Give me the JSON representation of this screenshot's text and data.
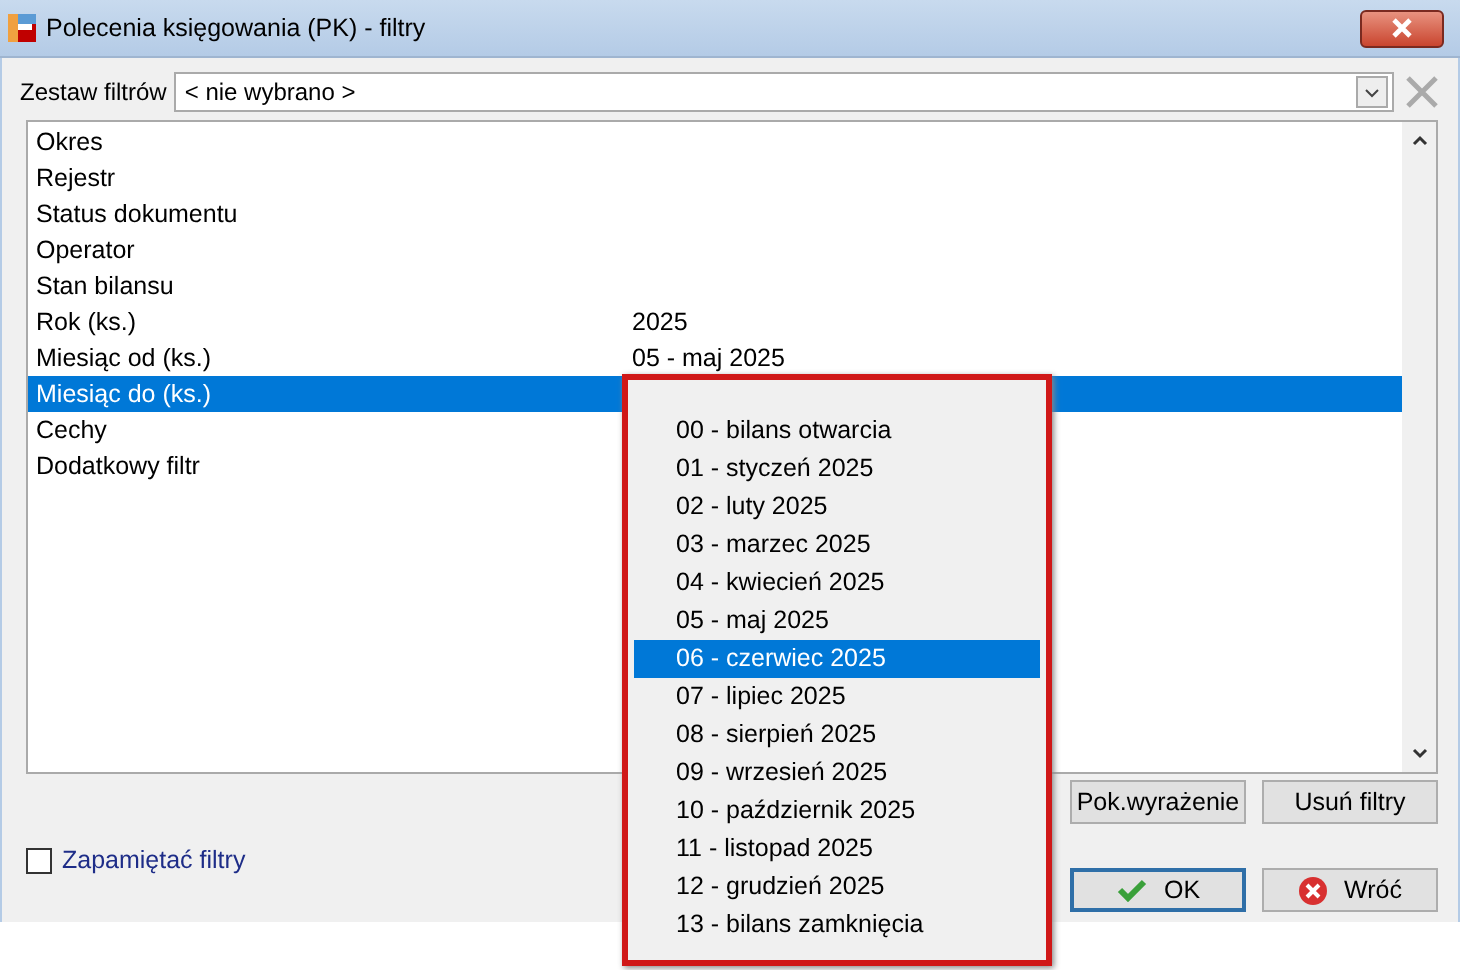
{
  "window": {
    "title": "Polecenia księgowania (PK) - filtry"
  },
  "filter_set": {
    "label": "Zestaw filtrów",
    "value": "< nie wybrano >"
  },
  "filters": [
    {
      "name": "Okres",
      "selected": false
    },
    {
      "name": "Rejestr",
      "selected": false
    },
    {
      "name": "Status dokumentu",
      "selected": false
    },
    {
      "name": "Operator",
      "selected": false
    },
    {
      "name": "Stan bilansu",
      "selected": false
    },
    {
      "name": "Rok (ks.)",
      "value": "2025",
      "selected": false
    },
    {
      "name": "Miesiąc od (ks.)",
      "value": "05 - maj 2025",
      "selected": false
    },
    {
      "name": "Miesiąc do (ks.)",
      "selected": true
    },
    {
      "name": "Cechy",
      "selected": false
    },
    {
      "name": "Dodatkowy filtr",
      "selected": false
    }
  ],
  "dropdown": {
    "items": [
      {
        "label": "00 - bilans otwarcia",
        "selected": false
      },
      {
        "label": "01 - styczeń 2025",
        "selected": false
      },
      {
        "label": "02 - luty 2025",
        "selected": false
      },
      {
        "label": "03 - marzec 2025",
        "selected": false
      },
      {
        "label": "04 - kwiecień 2025",
        "selected": false
      },
      {
        "label": "05 - maj 2025",
        "selected": false
      },
      {
        "label": "06 - czerwiec 2025",
        "selected": true
      },
      {
        "label": "07 - lipiec 2025",
        "selected": false
      },
      {
        "label": "08 - sierpień 2025",
        "selected": false
      },
      {
        "label": "09 - wrzesień 2025",
        "selected": false
      },
      {
        "label": "10 - październik 2025",
        "selected": false
      },
      {
        "label": "11 - listopad 2025",
        "selected": false
      },
      {
        "label": "12 - grudzień 2025",
        "selected": false
      },
      {
        "label": "13 - bilans zamknięcia",
        "selected": false
      }
    ]
  },
  "remember_filters": {
    "label": "Zapamiętać filtry",
    "checked": false
  },
  "buttons": [
    {
      "label": "Pok.wyrażenie",
      "kind": "plain"
    },
    {
      "label": "Usuń filtry",
      "kind": "plain"
    },
    {
      "label": "OK",
      "kind": "ok"
    },
    {
      "label": "Wróć",
      "kind": "cancel"
    }
  ]
}
